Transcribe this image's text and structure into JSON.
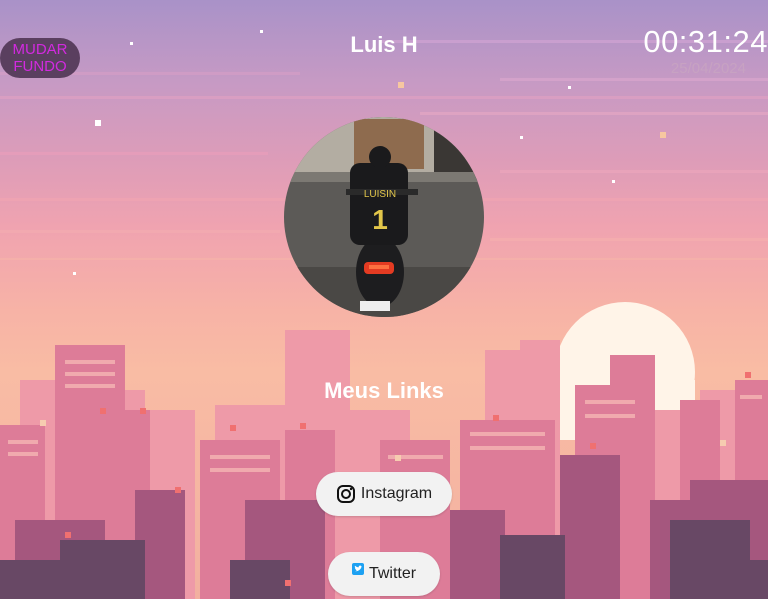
{
  "header": {
    "change_bg_label_line1": "MUDAR",
    "change_bg_label_line2": "FUNDO",
    "title": "Luis H",
    "time": "00:31:24",
    "date": "25/04/2024"
  },
  "profile": {
    "jersey_name": "LUISIN",
    "jersey_number": "1"
  },
  "links_section": {
    "heading": "Meus Links",
    "links": [
      {
        "label": "Instagram",
        "icon": "instagram-icon"
      },
      {
        "label": "Twitter",
        "icon": "twitter-icon"
      }
    ]
  },
  "colors": {
    "sky_top": "#a992c8",
    "sky_bottom": "#f9bca4",
    "sun": "#fff6ea",
    "button_bg": "#f2f2f2",
    "change_bg_text": "#d22adf",
    "change_bg_bg": "#5a3f5f"
  }
}
